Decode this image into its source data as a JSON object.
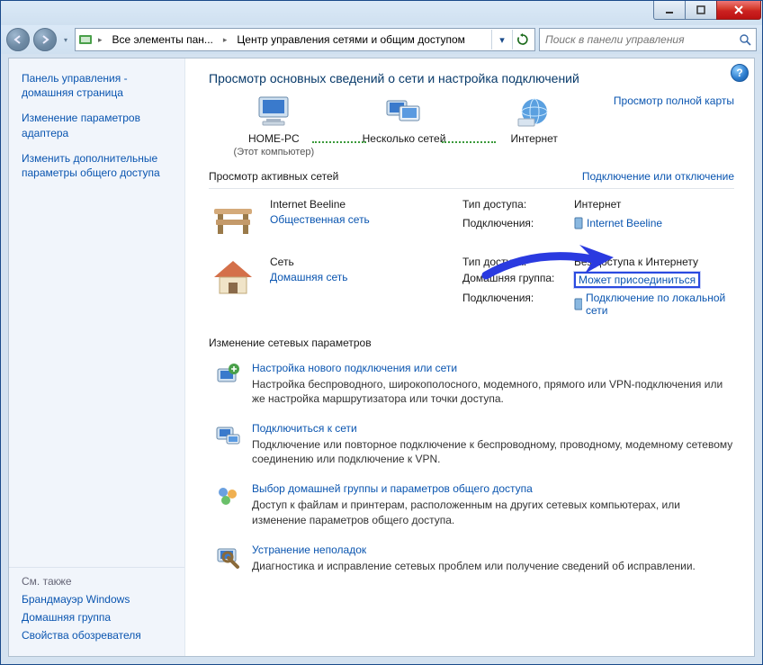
{
  "breadcrumb": {
    "seg1": "Все элементы пан...",
    "seg2": "Центр управления сетями и общим доступом"
  },
  "search": {
    "placeholder": "Поиск в панели управления"
  },
  "sidebar": {
    "links": [
      "Панель управления - домашняя страница",
      "Изменение параметров адаптера",
      "Изменить дополнительные параметры общего доступа"
    ],
    "also_hdr": "См. также",
    "also": [
      "Брандмауэр Windows",
      "Домашняя группа",
      "Свойства обозревателя"
    ]
  },
  "page_title": "Просмотр основных сведений о сети и настройка подключений",
  "map": {
    "node1_name": "HOME-PC",
    "node1_sub": "(Этот компьютер)",
    "node2_name": "Несколько сетей",
    "node3_name": "Интернет",
    "full_map_link": "Просмотр полной карты"
  },
  "active_hdr": "Просмотр активных сетей",
  "active_link": "Подключение или отключение",
  "net1": {
    "name": "Internet Beeline",
    "type": "Общественная сеть",
    "access_lbl": "Тип доступа:",
    "access_val": "Интернет",
    "conn_lbl": "Подключения:",
    "conn_val": "Internet Beeline"
  },
  "net2": {
    "name": "Сеть",
    "type": "Домашняя сеть",
    "access_lbl": "Тип доступа:",
    "access_val": "Без доступа к Интернету",
    "group_lbl": "Домашняя группа:",
    "group_val": "Может присоединиться",
    "conn_lbl": "Подключения:",
    "conn_val": "Подключение по локальной сети"
  },
  "change_hdr": "Изменение сетевых параметров",
  "tasks": [
    {
      "title": "Настройка нового подключения или сети",
      "desc": "Настройка беспроводного, широкополосного, модемного, прямого или VPN-подключения или же настройка маршрутизатора или точки доступа."
    },
    {
      "title": "Подключиться к сети",
      "desc": "Подключение или повторное подключение к беспроводному, проводному, модемному сетевому соединению или подключение к VPN."
    },
    {
      "title": "Выбор домашней группы и параметров общего доступа",
      "desc": "Доступ к файлам и принтерам, расположенным на других сетевых компьютерах, или изменение параметров общего доступа."
    },
    {
      "title": "Устранение неполадок",
      "desc": "Диагностика и исправление сетевых проблем или получение сведений об исправлении."
    }
  ]
}
